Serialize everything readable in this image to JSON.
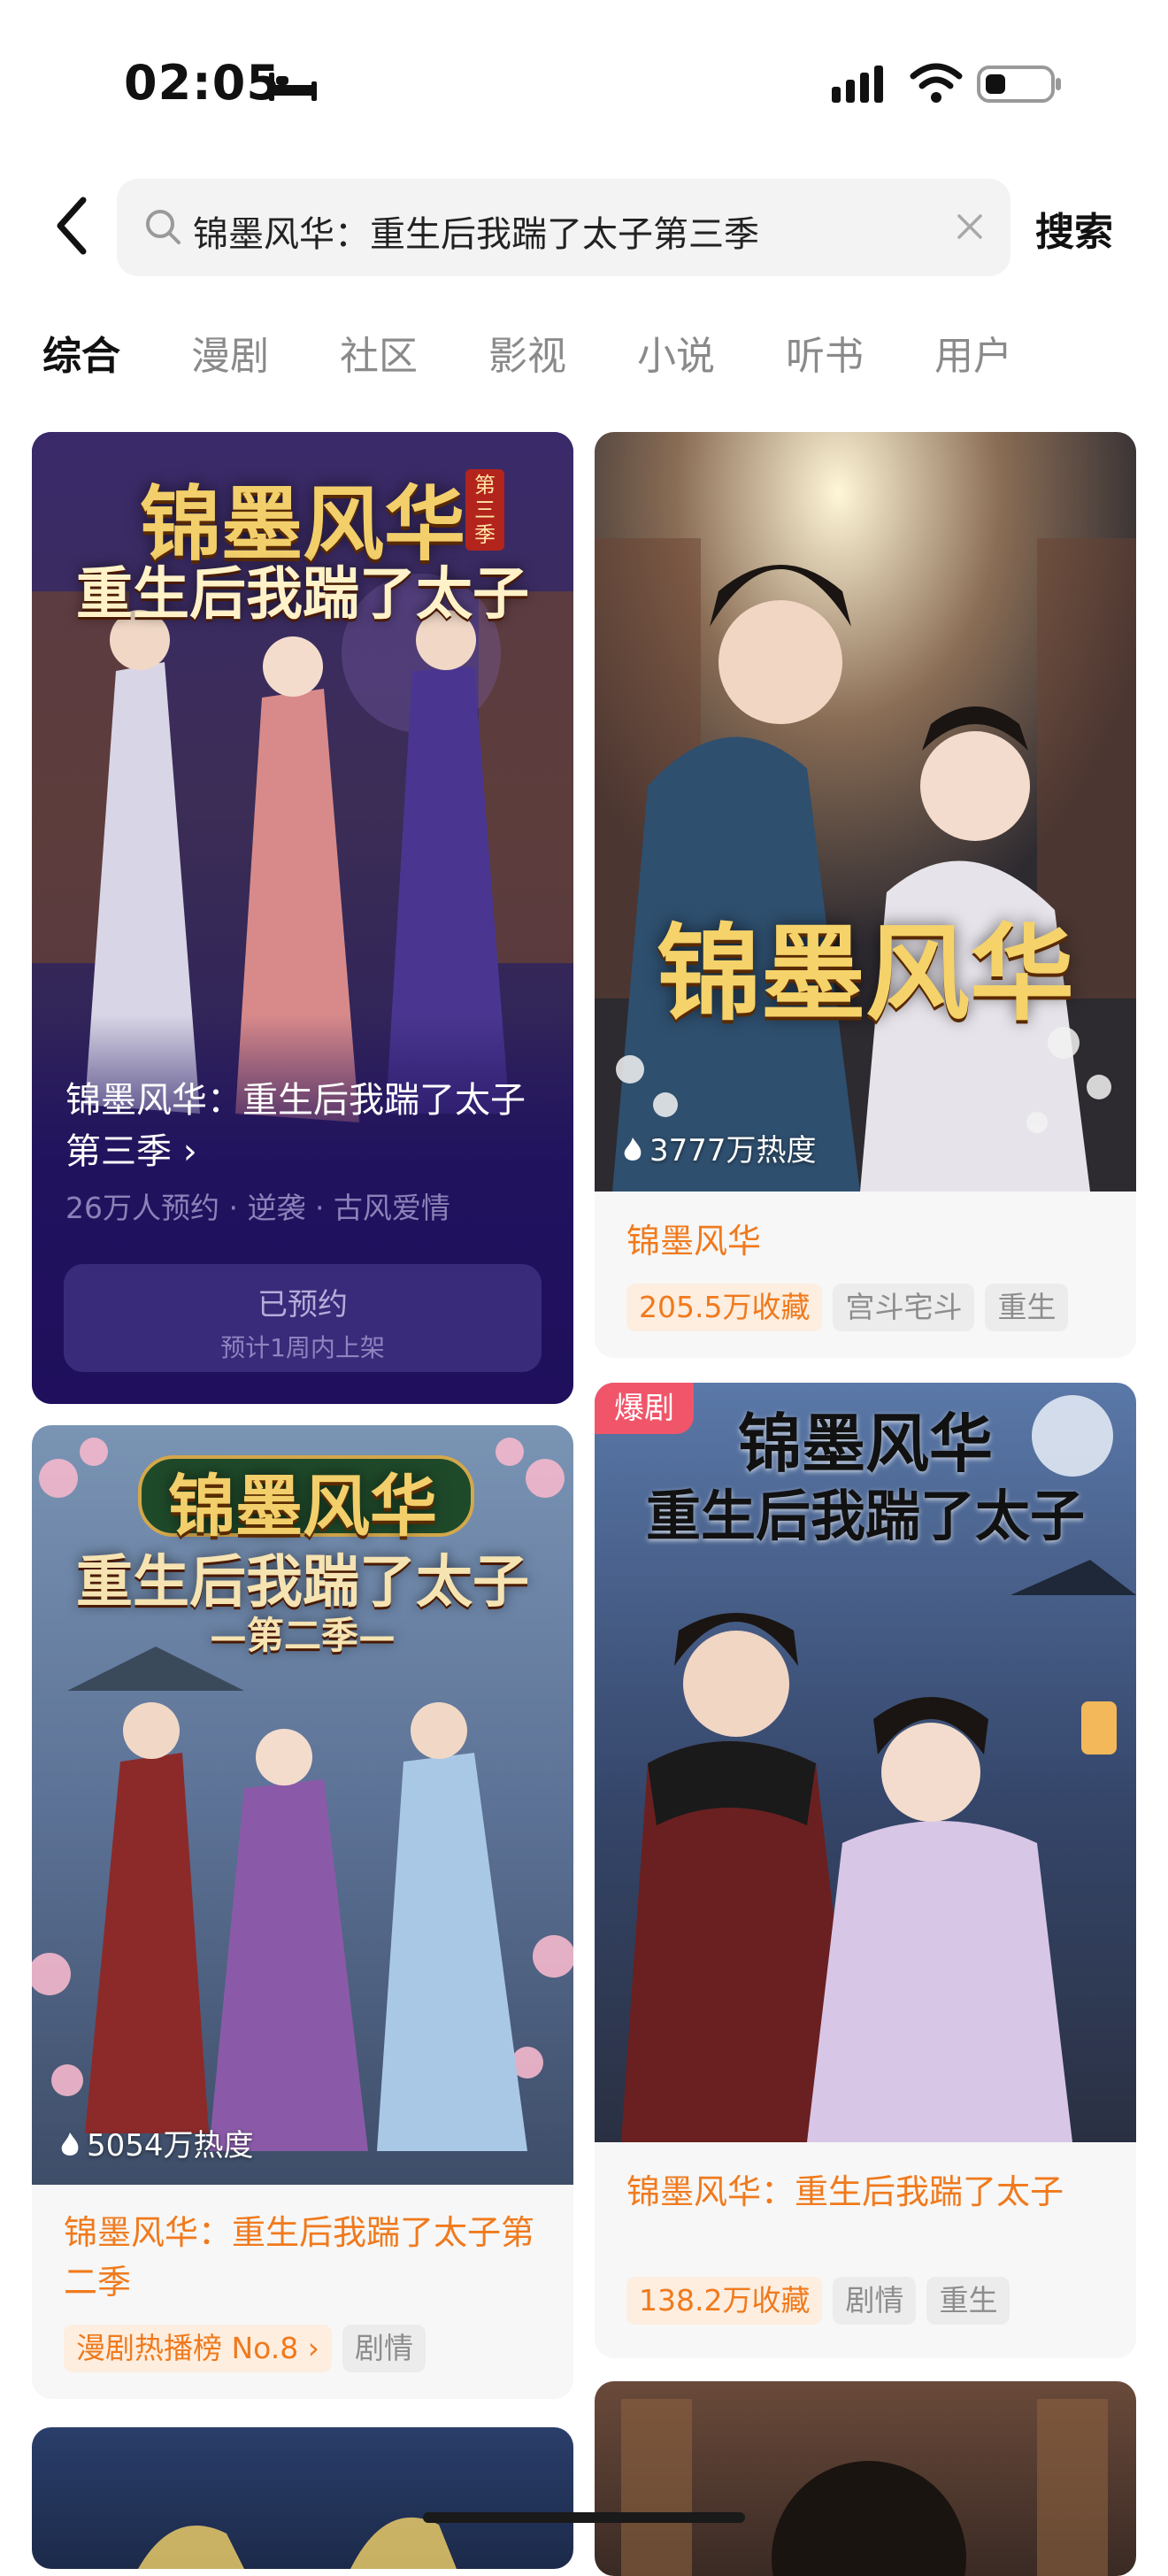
{
  "status_bar": {
    "time": "02:05",
    "icons": [
      "bed-icon",
      "signal-icon",
      "wifi-icon",
      "battery-icon"
    ]
  },
  "search": {
    "query": "锦墨风华：重生后我踹了太子第三季",
    "submit_label": "搜索",
    "icons": [
      "back-icon",
      "search-icon",
      "clear-icon"
    ]
  },
  "tabs": [
    {
      "label": "综合",
      "active": true
    },
    {
      "label": "漫剧",
      "active": false
    },
    {
      "label": "社区",
      "active": false
    },
    {
      "label": "影视",
      "active": false
    },
    {
      "label": "小说",
      "active": false
    },
    {
      "label": "听书",
      "active": false
    },
    {
      "label": "用户",
      "active": false
    }
  ],
  "cards": {
    "c1": {
      "poster_title": "锦墨风华",
      "poster_tag": "第三季",
      "poster_subtitle": "重生后我踹了太子",
      "title": "锦墨风华：重生后我踹了太子第三季",
      "chevron": "›",
      "meta": "26万人预约 · 逆袭 · 古风爱情",
      "button_label": "已预约",
      "button_sub": "预计1周内上架"
    },
    "c2": {
      "poster_title": "锦墨风华",
      "heat": "3777万热度",
      "title": "锦墨风华",
      "tags": [
        "205.5万收藏",
        "宫斗宅斗",
        "重生"
      ]
    },
    "c3": {
      "poster_title": "锦墨风华",
      "poster_subtitle": "重生后我踹了太子",
      "poster_season": "—第二季—",
      "heat": "5054万热度",
      "title": "锦墨风华：重生后我踹了太子第二季",
      "tags": [
        "漫剧热播榜 No.8 ›",
        "剧情"
      ]
    },
    "c4": {
      "badge": "爆剧",
      "poster_title": "锦墨风华",
      "poster_subtitle": "重生后我踹了太子",
      "title": "锦墨风华：重生后我踹了太子",
      "tags": [
        "138.2万收藏",
        "剧情",
        "重生"
      ]
    }
  },
  "colors": {
    "accent": "#f07a1d",
    "tag_bg": "#fdeee0",
    "reserve_bg": "#1f0f5c",
    "hot_badge": "#f0556a"
  }
}
